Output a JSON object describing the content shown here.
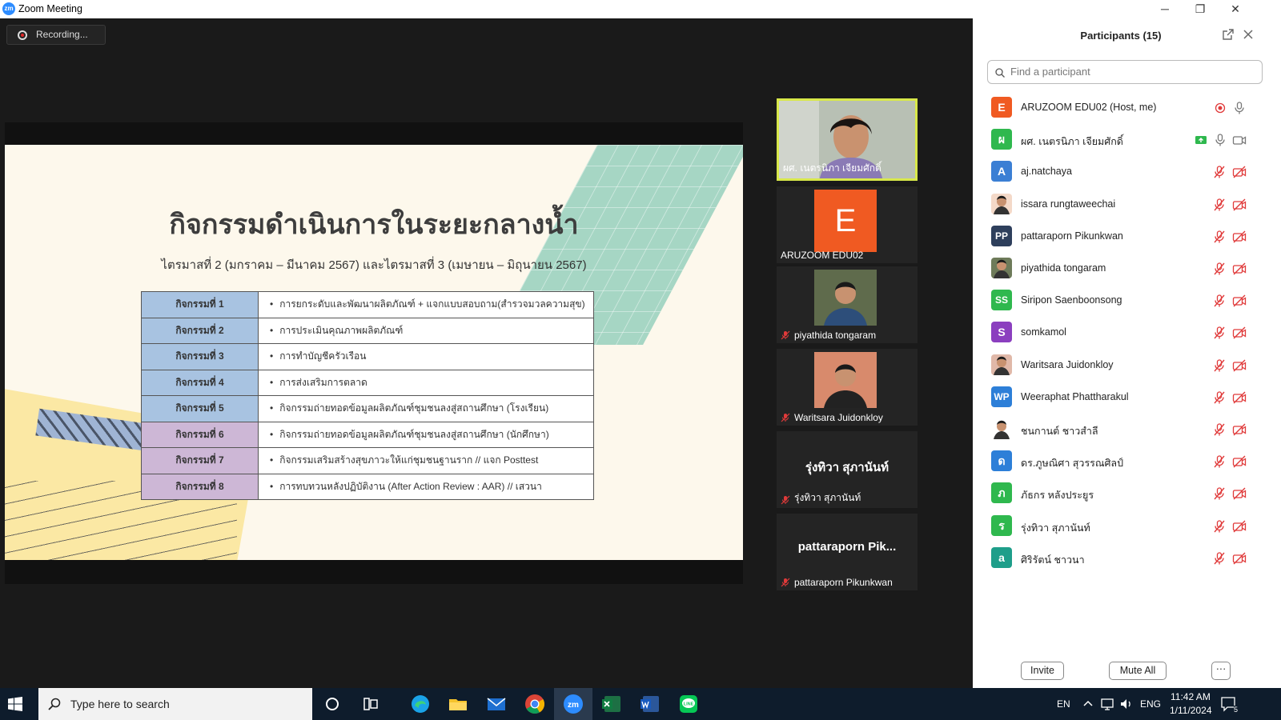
{
  "window": {
    "title": "Zoom Meeting",
    "minimize": "─",
    "restore": "❐",
    "close": "✕"
  },
  "recording": {
    "label": "Recording..."
  },
  "slide": {
    "title": "กิจกรรมดำเนินการในระยะกลางน้ำ",
    "subtitle": "ไตรมาสที่ 2 (มกราคม – มีนาคม 2567) และไตรมาสที่ 3 (เมษายน – มิถุนายน 2567)",
    "rows": [
      {
        "label": "กิจกรรมที่ 1",
        "text": "การยกระดับและพัฒนาผลิตภัณฑ์ + แจกแบบสอบถาม(สำรวจมวลความสุข)",
        "color": "#a8c3e1"
      },
      {
        "label": "กิจกรรมที่ 2",
        "text": "การประเมินคุณภาพผลิตภัณฑ์",
        "color": "#a8c3e1"
      },
      {
        "label": "กิจกรรมที่ 3",
        "text": "การทำบัญชีครัวเรือน",
        "color": "#a8c3e1"
      },
      {
        "label": "กิจกรรมที่ 4",
        "text": "การส่งเสริมการตลาด",
        "color": "#a8c3e1"
      },
      {
        "label": "กิจกรรมที่ 5",
        "text": "กิจกรรมถ่ายทอดข้อมูลผลิตภัณฑ์ชุมชนลงสู่สถานศึกษา (โรงเรียน)",
        "color": "#a8c3e1"
      },
      {
        "label": "กิจกรรมที่ 6",
        "text": "กิจกรรมถ่ายทอดข้อมูลผลิตภัณฑ์ชุมชนลงสู่สถานศึกษา (นักศึกษา)",
        "color": "#cdb7d6"
      },
      {
        "label": "กิจกรรมที่ 7",
        "text": "กิจกรรมเสริมสร้างสุขภาวะให้แก่ชุมชนฐานราก // แจก Posttest",
        "color": "#cdb7d6"
      },
      {
        "label": "กิจกรรมที่ 8",
        "text": "การทบทวนหลังปฏิบัติงาน (After Action Review : AAR) // เสวนา",
        "color": "#cdb7d6"
      }
    ]
  },
  "tiles": [
    {
      "name": "ผศ. เนตรนิภา เจียมศักดิ์",
      "kind": "video",
      "active": true,
      "muted": false
    },
    {
      "name": "ARUZOOM EDU02",
      "kind": "letter",
      "letter": "E",
      "muted": false
    },
    {
      "name": "piyathida tongaram",
      "kind": "photo",
      "muted": true
    },
    {
      "name": "Waritsara Juidonkloy",
      "kind": "photo",
      "muted": true
    },
    {
      "name": "รุ่งทิวา สุภานันท์",
      "kind": "text",
      "big": "รุ่งทิวา สุภานันท์",
      "muted": true
    },
    {
      "name": "pattaraporn Pikunkwan",
      "kind": "text",
      "big": "pattaraporn  Pik...",
      "muted": true
    }
  ],
  "participants_panel": {
    "title": "Participants (15)",
    "search_placeholder": "Find a participant",
    "invite_label": "Invite",
    "mute_all_label": "Mute All",
    "more_label": "···"
  },
  "participants": [
    {
      "name": "ARUZOOM EDU02 (Host, me)",
      "avatar": "E",
      "color": "#f05a22",
      "status": "host"
    },
    {
      "name": "ผศ. เนตรนิภา เจียมศักดิ์",
      "avatar": "ผ",
      "color": "#2fb84e",
      "status": "sharing"
    },
    {
      "name": "aj.natchaya",
      "avatar": "A",
      "color": "#3b7fd4",
      "status": "muted"
    },
    {
      "name": "issara rungtaweechai",
      "avatar": "",
      "color": "#f4d9c8",
      "status": "muted",
      "image": true
    },
    {
      "name": "pattaraporn Pikunkwan",
      "avatar": "PP",
      "color": "#2e3f5c",
      "status": "muted"
    },
    {
      "name": "piyathida tongaram",
      "avatar": "",
      "color": "#6e7b5a",
      "status": "muted",
      "image": true
    },
    {
      "name": "Siripon Saenboonsong",
      "avatar": "SS",
      "color": "#2fb84e",
      "status": "muted"
    },
    {
      "name": "somkamol",
      "avatar": "S",
      "color": "#8b3fbf",
      "status": "muted"
    },
    {
      "name": "Waritsara Juidonkloy",
      "avatar": "",
      "color": "#e0b8a8",
      "status": "muted",
      "image": true
    },
    {
      "name": "Weeraphat Phattharakul",
      "avatar": "WP",
      "color": "#2d7fd8",
      "status": "muted"
    },
    {
      "name": "ชนกานต์ ชาวสำลี",
      "avatar": "",
      "color": "#ffffff",
      "status": "muted",
      "image": true
    },
    {
      "name": "ดร.ภูษณิศา สุวรรณศิลป์",
      "avatar": "ด",
      "color": "#2d7fd8",
      "status": "muted"
    },
    {
      "name": "ภัธกร หลังประยูร",
      "avatar": "ภ",
      "color": "#2fb84e",
      "status": "muted"
    },
    {
      "name": "รุ่งทิวา สุภานันท์",
      "avatar": "ร",
      "color": "#2fb84e",
      "status": "muted"
    },
    {
      "name": "ศิริรัตน์ ชาวนา",
      "avatar": "a",
      "color": "#1e9e8a",
      "status": "muted"
    }
  ],
  "taskbar": {
    "search_placeholder": "Type here to search",
    "lang": "EN",
    "ime": "ENG",
    "time": "11:42 AM",
    "date": "1/11/2024",
    "notifications": "5"
  }
}
